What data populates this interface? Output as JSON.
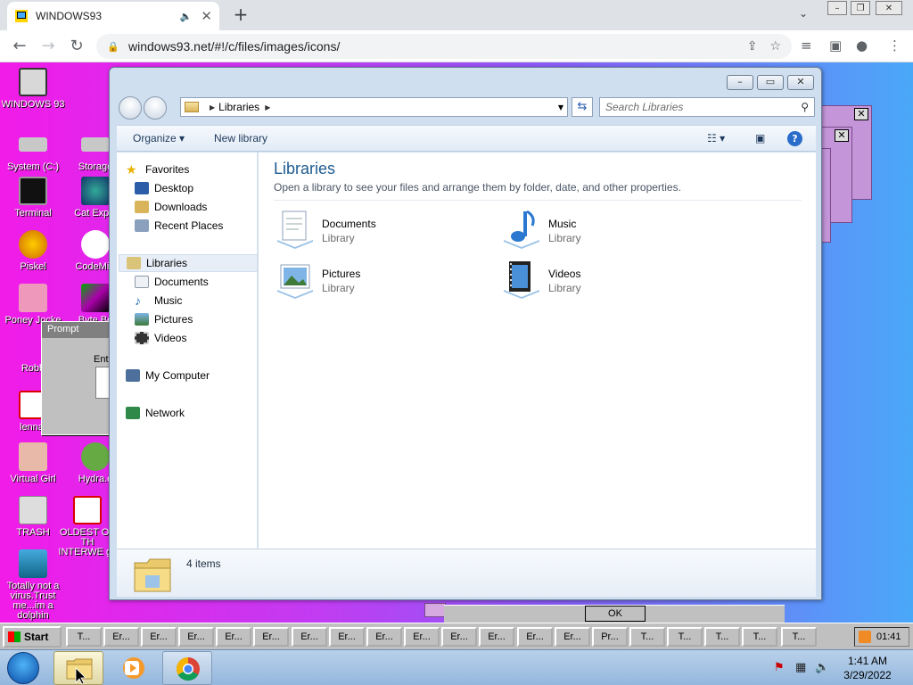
{
  "browser": {
    "tab_title": "WINDOWS93",
    "new_tab_label": "+",
    "url": "windows93.net/#!/c/files/images/icons/"
  },
  "desktop": {
    "icons": [
      {
        "label": "WINDOWS 93"
      },
      {
        "label": "System (C:)"
      },
      {
        "label": "Storage"
      },
      {
        "label": "Terminal"
      },
      {
        "label": "Cat Explo"
      },
      {
        "label": "Piskel"
      },
      {
        "label": "CodeMirr"
      },
      {
        "label": "Poney Jocke"
      },
      {
        "label": "Byte Be"
      },
      {
        "label": "Robb"
      },
      {
        "label": "lenna."
      },
      {
        "label": "Virtual Girl"
      },
      {
        "label": "Hydra.e"
      },
      {
        "label": "TRASH"
      },
      {
        "label": "OLDEST OF TH INTERWE gif"
      },
      {
        "label": "Totally not a virus.Trust me...im a dolphin"
      }
    ],
    "prompt": {
      "title": "Prompt",
      "label": "Ent"
    },
    "ok_label": "OK"
  },
  "explorer": {
    "breadcrumb": "Libraries",
    "search_placeholder": "Search Libraries",
    "commands": {
      "organize": "Organize",
      "new_library": "New library"
    },
    "nav": {
      "favorites": "Favorites",
      "desktop": "Desktop",
      "downloads": "Downloads",
      "recent": "Recent Places",
      "libraries": "Libraries",
      "documents": "Documents",
      "music": "Music",
      "pictures": "Pictures",
      "videos": "Videos",
      "computer": "My Computer",
      "network": "Network"
    },
    "heading": "Libraries",
    "subheading": "Open a library to see your files and arrange them by folder, date, and other properties.",
    "libraries": [
      {
        "name": "Documents",
        "type": "Library"
      },
      {
        "name": "Music",
        "type": "Library"
      },
      {
        "name": "Pictures",
        "type": "Library"
      },
      {
        "name": "Videos",
        "type": "Library"
      }
    ],
    "item_count": "4 items"
  },
  "w93_taskbar": {
    "start": "Start",
    "buttons": [
      "T...",
      "Er...",
      "Er...",
      "Er...",
      "Er...",
      "Er...",
      "Er...",
      "Er...",
      "Er...",
      "Er...",
      "Er...",
      "Er...",
      "Er...",
      "Er...",
      "Pr...",
      "T...",
      "T...",
      "T...",
      "T...",
      "T..."
    ],
    "clock": "01:41"
  },
  "w7_taskbar": {
    "time": "1:41 AM",
    "date": "3/29/2022"
  }
}
